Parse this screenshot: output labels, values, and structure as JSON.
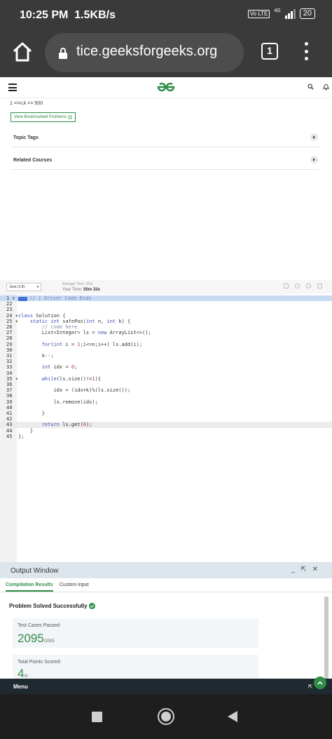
{
  "status_bar": {
    "time": "10:25 PM",
    "speed": "1.5KB/s",
    "volte": "Vo LTE",
    "network": "4G",
    "battery": "20"
  },
  "browser": {
    "url": "tice.geeksforgeeks.org",
    "tab_count": "1"
  },
  "problem": {
    "constraint": "1 <=n,k <= 500",
    "bookmarked_label": "View Bookmarked Problems",
    "topic_tags_label": "Topic Tags",
    "related_courses_label": "Related Courses"
  },
  "editor": {
    "language": "Java (1.8)",
    "average_time": "Average Time: 20m",
    "your_time_label": "Your Time:",
    "your_time_value": "50m 33s",
    "lines": [
      {
        "num": "1",
        "fold": true,
        "highlight": true,
        "text": "// } Driver Code Ends",
        "badge": "···"
      },
      {
        "num": "22",
        "text": ""
      },
      {
        "num": "23",
        "text": ""
      },
      {
        "num": "24",
        "fold": true,
        "text": "class Solution {"
      },
      {
        "num": "25",
        "fold": true,
        "text": "    static int safePos(int n, int k) {"
      },
      {
        "num": "26",
        "text": "        // code here"
      },
      {
        "num": "27",
        "text": "        List<Integer> ls = new ArrayList<>();"
      },
      {
        "num": "28",
        "text": ""
      },
      {
        "num": "29",
        "text": "        for(int i = 1;i<=n;i++) ls.add(i);"
      },
      {
        "num": "30",
        "text": ""
      },
      {
        "num": "31",
        "text": "        k--;"
      },
      {
        "num": "32",
        "text": ""
      },
      {
        "num": "33",
        "text": "        int idx = 0;"
      },
      {
        "num": "34",
        "text": ""
      },
      {
        "num": "35",
        "fold": true,
        "text": "        while(ls.size()!=1){"
      },
      {
        "num": "36",
        "text": ""
      },
      {
        "num": "37",
        "text": "            idx = (idx+k)%(ls.size());"
      },
      {
        "num": "38",
        "text": ""
      },
      {
        "num": "39",
        "text": "            ls.remove(idx);"
      },
      {
        "num": "40",
        "text": ""
      },
      {
        "num": "41",
        "text": "        }"
      },
      {
        "num": "42",
        "text": ""
      },
      {
        "num": "43",
        "current": true,
        "text": "        return ls.get(0);"
      },
      {
        "num": "44",
        "text": "    }"
      },
      {
        "num": "45",
        "text": "};"
      }
    ]
  },
  "output": {
    "title": "Output Window",
    "tab_compilation": "Compilation Results",
    "tab_custom": "Custom Input",
    "status": "Problem Solved Successfully",
    "test_cases_label": "Test Cases Passed:",
    "test_cases_value": "2095",
    "test_cases_total": "/2095",
    "points_label": "Total Points Scored:",
    "points_value": "4",
    "points_total": "/4"
  },
  "menu_label": "Menu",
  "colors": {
    "brand_green": "#2f8d46",
    "chrome_dark": "#3a3a3a",
    "menu_bar": "#1f2930"
  }
}
